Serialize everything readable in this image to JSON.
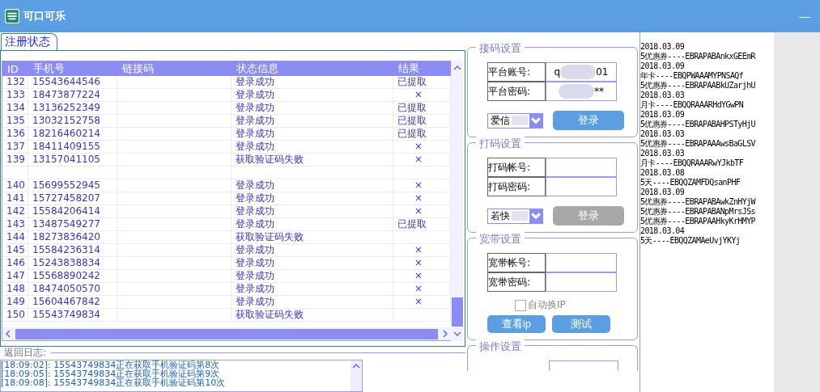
{
  "window": {
    "title": "可口可乐",
    "minimize": "—"
  },
  "tabs": [
    {
      "label": "注册状态",
      "selected": true
    }
  ],
  "table": {
    "columns": [
      "ID",
      "手机号",
      "链接码",
      "状态信息",
      "结果"
    ],
    "rows": [
      {
        "id": "132",
        "phone": "15543644546",
        "status": "登录成功",
        "result": "已提取",
        "kind": "extracted"
      },
      {
        "id": "133",
        "phone": "18473877224",
        "status": "登录成功",
        "result": "×",
        "kind": "fail"
      },
      {
        "id": "134",
        "phone": "13136252349",
        "status": "登录成功",
        "result": "已提取",
        "kind": "extracted"
      },
      {
        "id": "135",
        "phone": "13032152758",
        "status": "登录成功",
        "result": "已提取",
        "kind": "extracted"
      },
      {
        "id": "136",
        "phone": "18216460214",
        "status": "登录成功",
        "result": "已提取",
        "kind": "extracted"
      },
      {
        "id": "137",
        "phone": "18411409155",
        "status": "登录成功",
        "result": "×",
        "kind": "fail"
      },
      {
        "id": "139",
        "phone": "13157041105",
        "status": "获取验证码失败",
        "result": "×",
        "kind": "fail"
      },
      {
        "kind": "empty"
      },
      {
        "id": "140",
        "phone": "15699552945",
        "status": "登录成功",
        "result": "×",
        "kind": "fail"
      },
      {
        "id": "141",
        "phone": "15727458207",
        "status": "登录成功",
        "result": "×",
        "kind": "fail"
      },
      {
        "id": "142",
        "phone": "15584206414",
        "status": "登录成功",
        "result": "×",
        "kind": "fail"
      },
      {
        "id": "143",
        "phone": "13487549277",
        "status": "登录成功",
        "result": "已提取",
        "kind": "extracted"
      },
      {
        "id": "144",
        "phone": "18273836420",
        "status": "获取验证码失败",
        "kind": "none"
      },
      {
        "id": "145",
        "phone": "15584236314",
        "status": "登录成功",
        "result": "×",
        "kind": "fail"
      },
      {
        "id": "146",
        "phone": "15243838834",
        "status": "登录成功",
        "result": "×",
        "kind": "fail"
      },
      {
        "id": "147",
        "phone": "15568890242",
        "status": "登录成功",
        "result": "×",
        "kind": "fail"
      },
      {
        "id": "148",
        "phone": "18474050570",
        "status": "登录成功",
        "result": "×",
        "kind": "fail"
      },
      {
        "id": "149",
        "phone": "15604467842",
        "status": "登录成功",
        "result": "×",
        "kind": "fail"
      },
      {
        "id": "150",
        "phone": "15543749834",
        "status": "获取验证码失败",
        "kind": "none"
      }
    ]
  },
  "log": {
    "label": "返回日志:",
    "lines": [
      {
        "time": "[18:09:02]:",
        "text": " 15543749834正在获取手机验证码第8次"
      },
      {
        "time": "[18:09:05]:",
        "text": " 15543749834正在获取手机验证码第9次"
      },
      {
        "time": "[18:09:08]:",
        "text": " 15543749834正在获取手机验证码第10次"
      }
    ]
  },
  "groups": [
    {
      "title": "接码设置",
      "fields": [
        {
          "label": "平台账号:",
          "value_start": "q",
          "value_end": "01"
        },
        {
          "label": "平台密码:",
          "value_end": "**"
        }
      ],
      "select": "爱信",
      "button": "登录",
      "button_enabled": true
    },
    {
      "title": "打码设置",
      "fields": [
        {
          "label": "打码帐号:"
        },
        {
          "label": "打码密码:"
        }
      ],
      "select": "若快",
      "button": "登录",
      "button_enabled": false
    },
    {
      "title": "宽带设置",
      "fields": [
        {
          "label": "宽带帐号:"
        },
        {
          "label": "宽带密码:"
        }
      ],
      "checkbox": {
        "label": "自动换IP",
        "checked": false
      },
      "buttons": [
        "查看ip",
        "测试"
      ]
    },
    {
      "title": "操作设置"
    }
  ],
  "codes": [
    "2018.03.09",
    "5优惠券----EBRAPABAnkxGEEmR",
    "2018.03.09",
    "年卡----EBQPWAAAMYPNSAQf",
    "5优惠券----EBRAPAABkUZarjhU",
    "2018.03.03",
    "月卡----EBQQRAAARHdYGwPN",
    "2018.03.09",
    "5优惠券----EBRAPABAHPSTyHjU",
    "2018.03.03",
    "5优惠券----EBRAPAAAwsBaGLSV",
    "2018.03.03",
    "月卡----EBQQRAAARwYJkbTF",
    "2018.03.08",
    "5天----EBQQZAMFDQsanPHF",
    "2018.03.09",
    "5优惠券----EBRAPABAwkZnHYjW",
    "5优惠券----EBRAPABANpMrsJSs",
    "5优惠券----EBRAPAAHkyKrHMYP",
    "2018.03.04",
    "5天----EBQQZAMAeUvjYKYj"
  ]
}
